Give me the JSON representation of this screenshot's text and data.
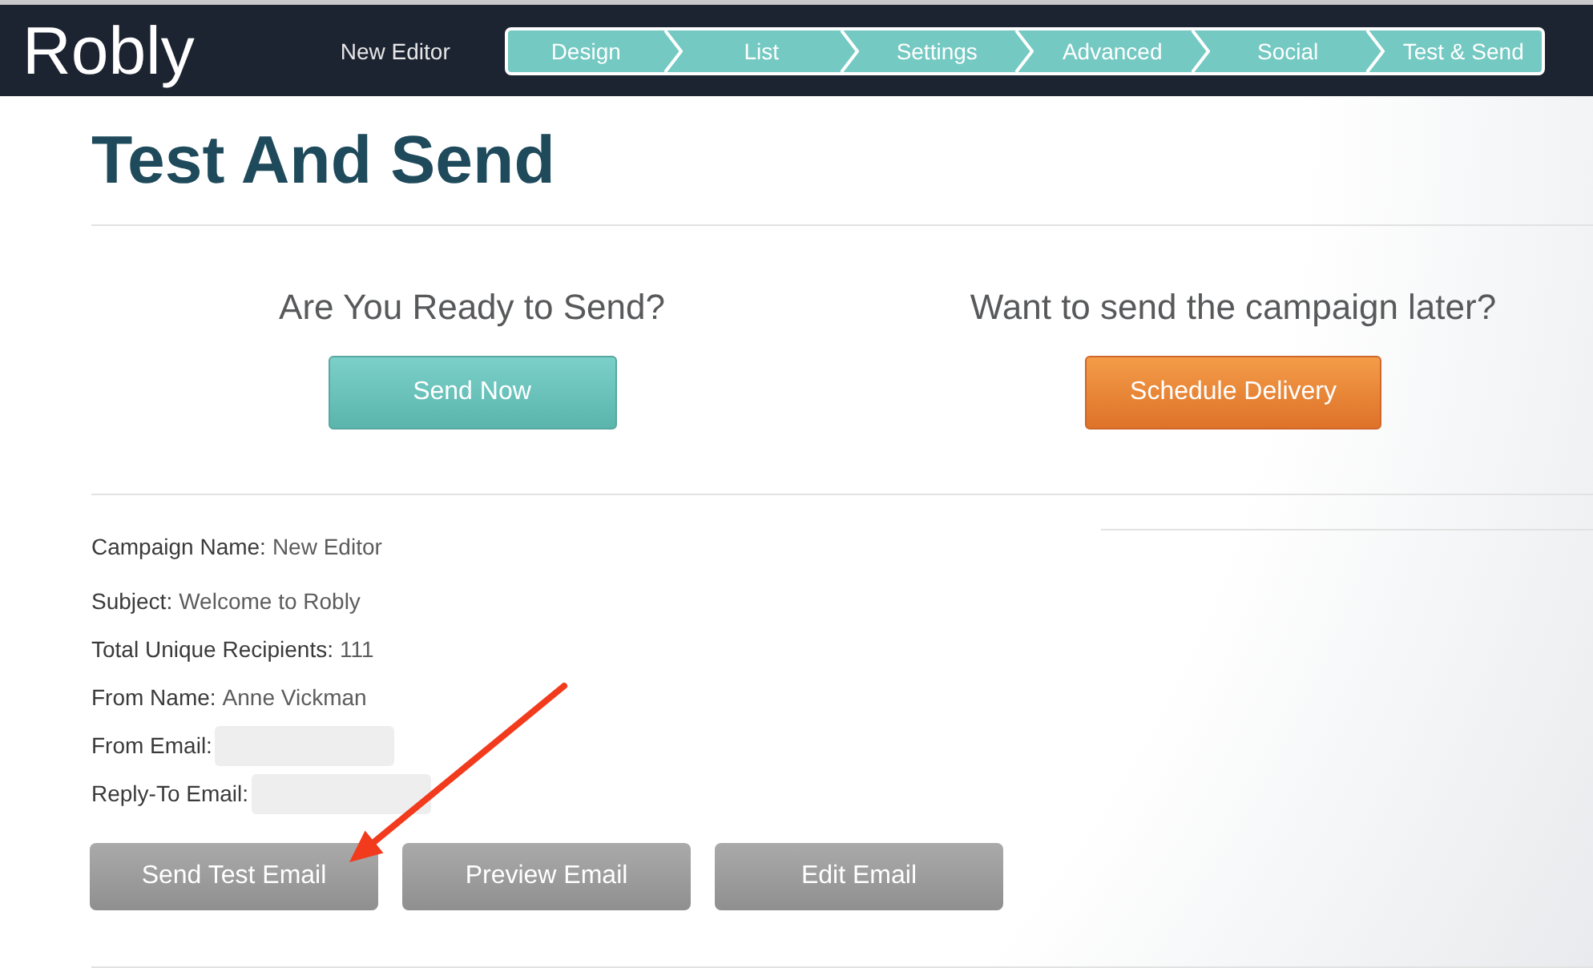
{
  "header": {
    "logo": "Robly",
    "campaign_name": "New Editor",
    "steps": [
      "Design",
      "List",
      "Settings",
      "Advanced",
      "Social",
      "Test & Send"
    ]
  },
  "page_title": "Test And Send",
  "send_options": [
    {
      "kind": "now",
      "heading": "Are You Ready to Send?",
      "button": "Send Now"
    },
    {
      "kind": "later",
      "heading": "Want to send the campaign later?",
      "button": "Schedule Delivery"
    }
  ],
  "details": [
    {
      "label": "Campaign Name:",
      "value": "New Editor",
      "redacted": false
    },
    {
      "label": "Subject:",
      "value": "Welcome to Robly",
      "redacted": false
    },
    {
      "label": "Total Unique Recipients:",
      "value": "111",
      "redacted": false
    },
    {
      "label": "From Name:",
      "value": "Anne Vickman",
      "redacted": false
    },
    {
      "label": "From Email:",
      "redacted": true
    },
    {
      "label": "Reply-To Email:",
      "redacted": true
    }
  ],
  "actions": [
    "Send Test Email",
    "Preview Email",
    "Edit Email"
  ]
}
